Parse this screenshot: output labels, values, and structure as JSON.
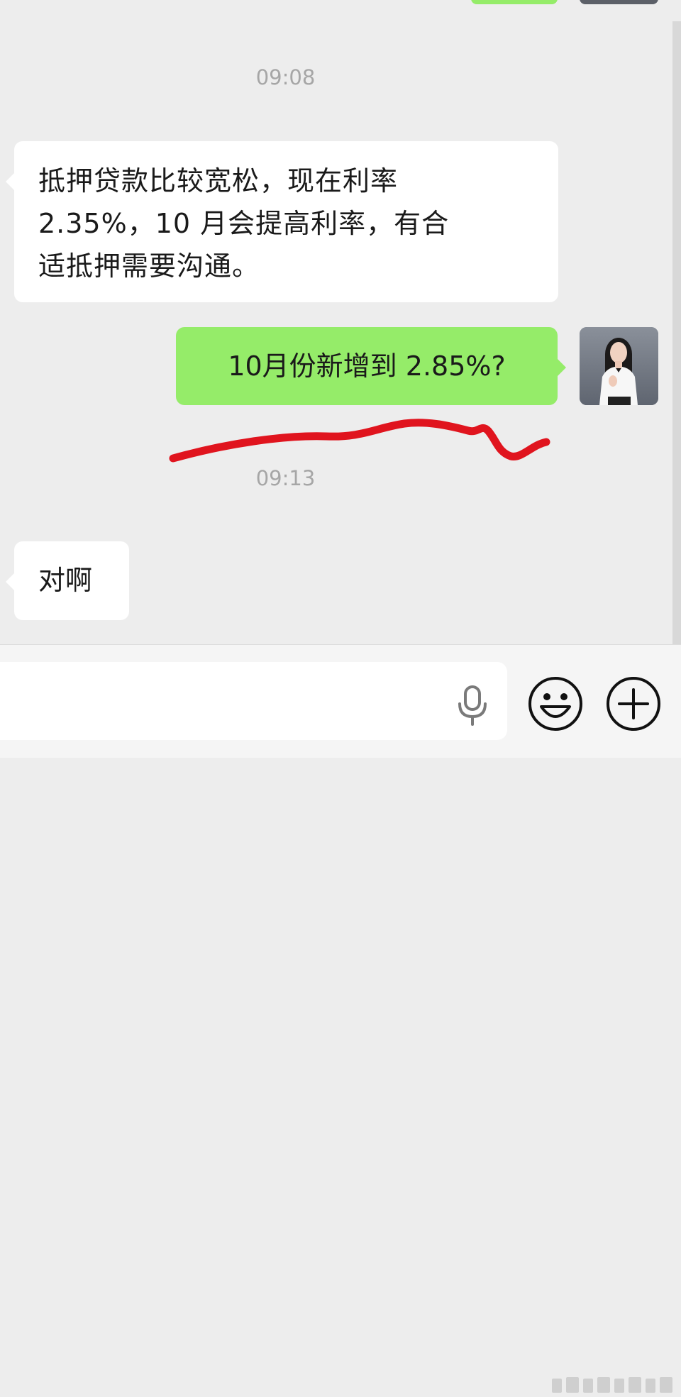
{
  "chat": {
    "timestamps": [
      "09:08",
      "09:13"
    ],
    "messages": [
      {
        "side": "left",
        "line1": "抵押贷款比较宽松，现在利率",
        "line2": "2.35%，10 月会提高利率，有合",
        "line3": "适抵押需要沟通。"
      },
      {
        "side": "right",
        "text": "10月份新增到 2.85%?"
      },
      {
        "side": "left",
        "text": "对啊"
      }
    ]
  },
  "input_bar": {
    "voice_icon": "microphone-icon",
    "emoji_icon": "emoji-smile-icon",
    "more_icon": "plus-circle-icon"
  },
  "colors": {
    "chat_background": "#ededed",
    "sent_bubble": "#95ec69",
    "received_bubble": "#ffffff",
    "timestamp_text": "#a6a6a6",
    "annotation_scribble": "#e0141e"
  }
}
